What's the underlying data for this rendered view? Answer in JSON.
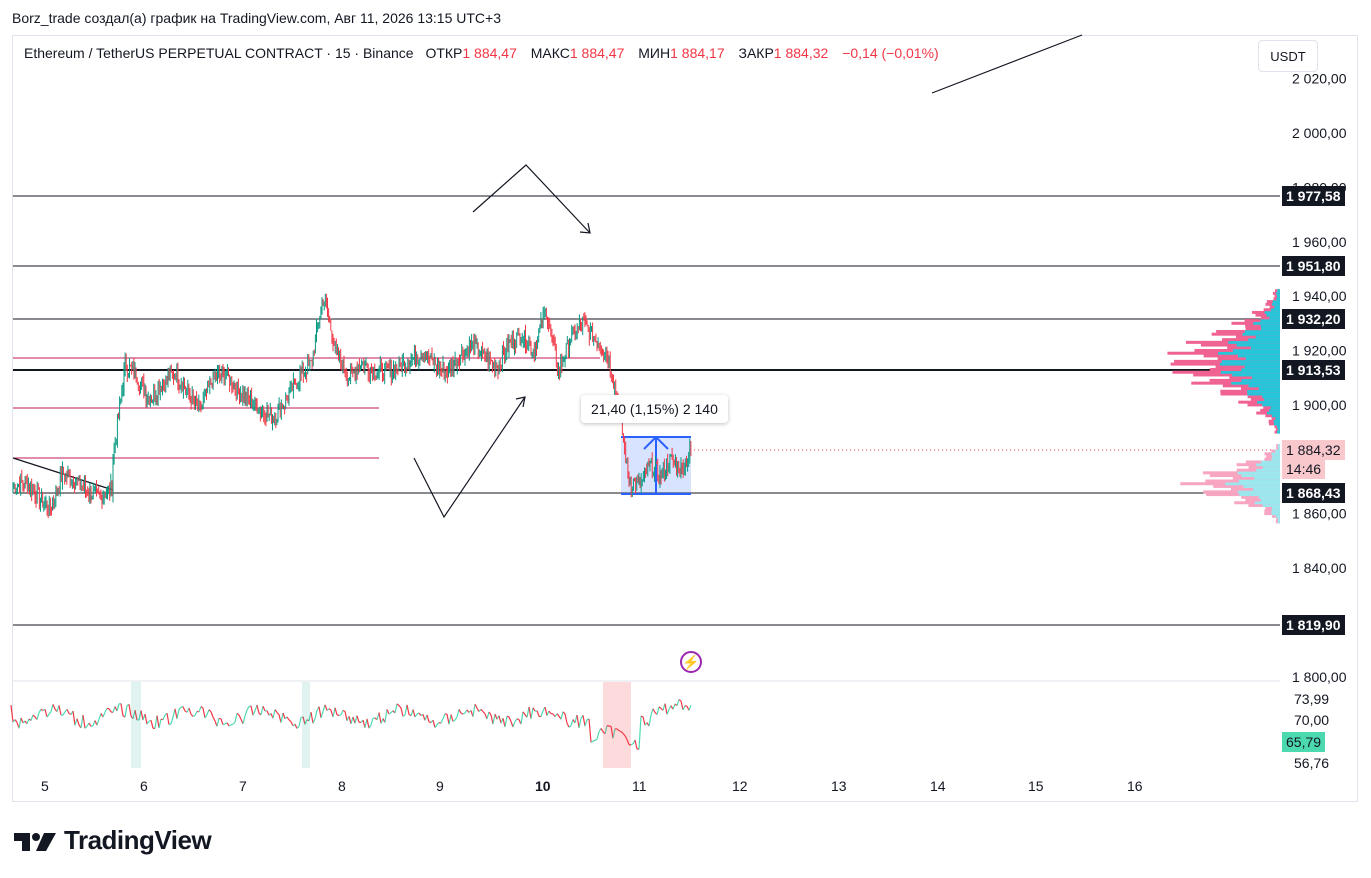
{
  "caption": "Borz_trade создал(а) график на TradingView.com, Авг 11, 2026 13:15 UTC+3",
  "legend": {
    "symbol": "Ethereum / TetherUS PERPETUAL CONTRACT · 15 · Binance",
    "open_label": "ОТКР",
    "open": "1 884,47",
    "high_label": "МАКС",
    "high": "1 884,47",
    "low_label": "МИН",
    "low": "1 884,17",
    "close_label": "ЗАКР",
    "close": "1 884,32",
    "change": "−0,14 (−0,01%)"
  },
  "currency": "USDT",
  "price_axis": [
    "2 020,00",
    "2 000,00",
    "1 980,00",
    "1 960,00",
    "1 940,00",
    "1 920,00",
    "1 900,00",
    "1 860,00",
    "1 840,00",
    "1 800,00"
  ],
  "price_tags": {
    "l1977": "1 977,58",
    "l1951": "1 951,80",
    "l1932": "1 932,20",
    "l1913": "1 913,53",
    "last": "1 884,32",
    "countdown": "14:46",
    "l1868": "1 868,43",
    "l1819": "1 819,90"
  },
  "measure_tip": "21,40 (1,15%) 2 140",
  "rsi": {
    "axis": [
      "73,99",
      "70,00",
      "56,76"
    ],
    "current": "65,79"
  },
  "time_axis": [
    "5",
    "6",
    "7",
    "8",
    "9",
    "10",
    "11",
    "12",
    "13",
    "14",
    "15",
    "16"
  ],
  "logo": "TradingView",
  "colors": {
    "up": "#089981",
    "down": "#f23645",
    "line": "#131722",
    "vp_up": "#26c6da",
    "vp_down": "#f06292",
    "measure": "#2962ff",
    "rsi_up": "#4dd9b0",
    "rsi_down": "#f23645"
  },
  "chart_data": {
    "type": "candlestick",
    "symbol": "Ethereum / TetherUS PERPETUAL CONTRACT",
    "interval": "15",
    "ylim": [
      1793,
      2027
    ],
    "horizontal_levels": [
      1977.58,
      1951.8,
      1932.2,
      1913.53,
      1868.43,
      1819.9
    ],
    "path_day_1": [
      1870,
      1872,
      1866,
      1862,
      1875,
      1872,
      1868,
      1866,
      1870
    ],
    "path_day_2": [
      1880,
      1915,
      1910,
      1902,
      1908,
      1912,
      1905,
      1898,
      1909
    ],
    "path_day_3": [
      1909,
      1912,
      1906,
      1902,
      1898,
      1895,
      1902,
      1910,
      1915
    ],
    "path_day_4": [
      1915,
      1940,
      1920,
      1910,
      1915,
      1913,
      1912,
      1914,
      1916
    ],
    "path_day_5": [
      1916,
      1920,
      1915,
      1912,
      1918,
      1922,
      1918,
      1914,
      1922
    ],
    "path_day_6": [
      1922,
      1926,
      1920,
      1935,
      1912,
      1925,
      1930,
      1924,
      1918
    ],
    "path_day_7": [
      1918,
      1900,
      1872,
      1870,
      1878,
      1874,
      1880,
      1876,
      1884
    ]
  }
}
